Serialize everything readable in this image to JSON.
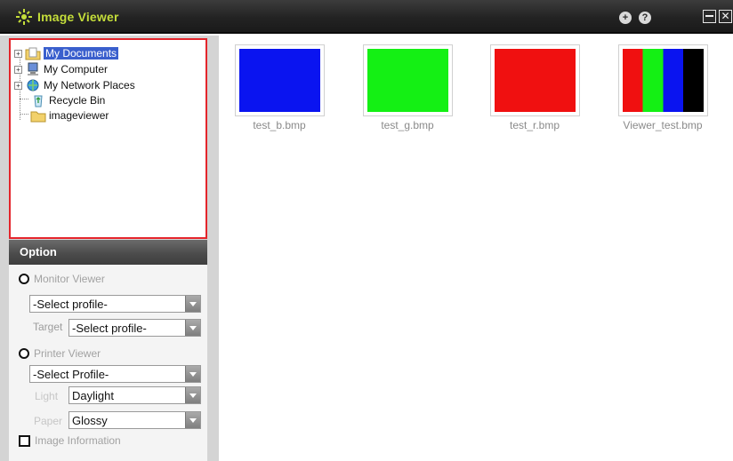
{
  "window": {
    "title": "Image Viewer",
    "controls": {
      "plus_icon": "+",
      "help_icon": "?",
      "minimize_icon": "—",
      "close_icon": "✕"
    }
  },
  "tree": {
    "items": [
      {
        "label": "My Documents",
        "icon": "documents-folder-icon",
        "selected": true
      },
      {
        "label": "My Computer",
        "icon": "computer-icon"
      },
      {
        "label": "My Network Places",
        "icon": "network-places-icon"
      },
      {
        "label": "Recycle Bin",
        "icon": "recycle-bin-icon"
      },
      {
        "label": "imageviewer",
        "icon": "folder-icon"
      }
    ]
  },
  "option": {
    "header": "Option",
    "monitor_viewer": {
      "label": "Monitor Viewer",
      "profile_select": "-Select profile-",
      "target_label": "Target",
      "target_select": "-Select profile-"
    },
    "printer_viewer": {
      "label": "Printer Viewer",
      "profile_select": "-Select Profile-",
      "light_label": "Light",
      "light_select": "Daylight",
      "paper_label": "Paper",
      "paper_select": "Glossy"
    },
    "image_information": "Image Information"
  },
  "thumbnails": [
    {
      "caption": "test_b.bmp",
      "colors": [
        "#0a14f0"
      ]
    },
    {
      "caption": "test_g.bmp",
      "colors": [
        "#14f014"
      ]
    },
    {
      "caption": "test_r.bmp",
      "colors": [
        "#f01010"
      ]
    },
    {
      "caption": "Viewer_test.bmp",
      "colors": [
        "#f01010",
        "#14f014",
        "#0a14f0",
        "#000000"
      ]
    }
  ],
  "colors": {
    "title_text": "#c4dd3a",
    "tree_border": "#e4242b",
    "selection": "#3a5fcd"
  }
}
